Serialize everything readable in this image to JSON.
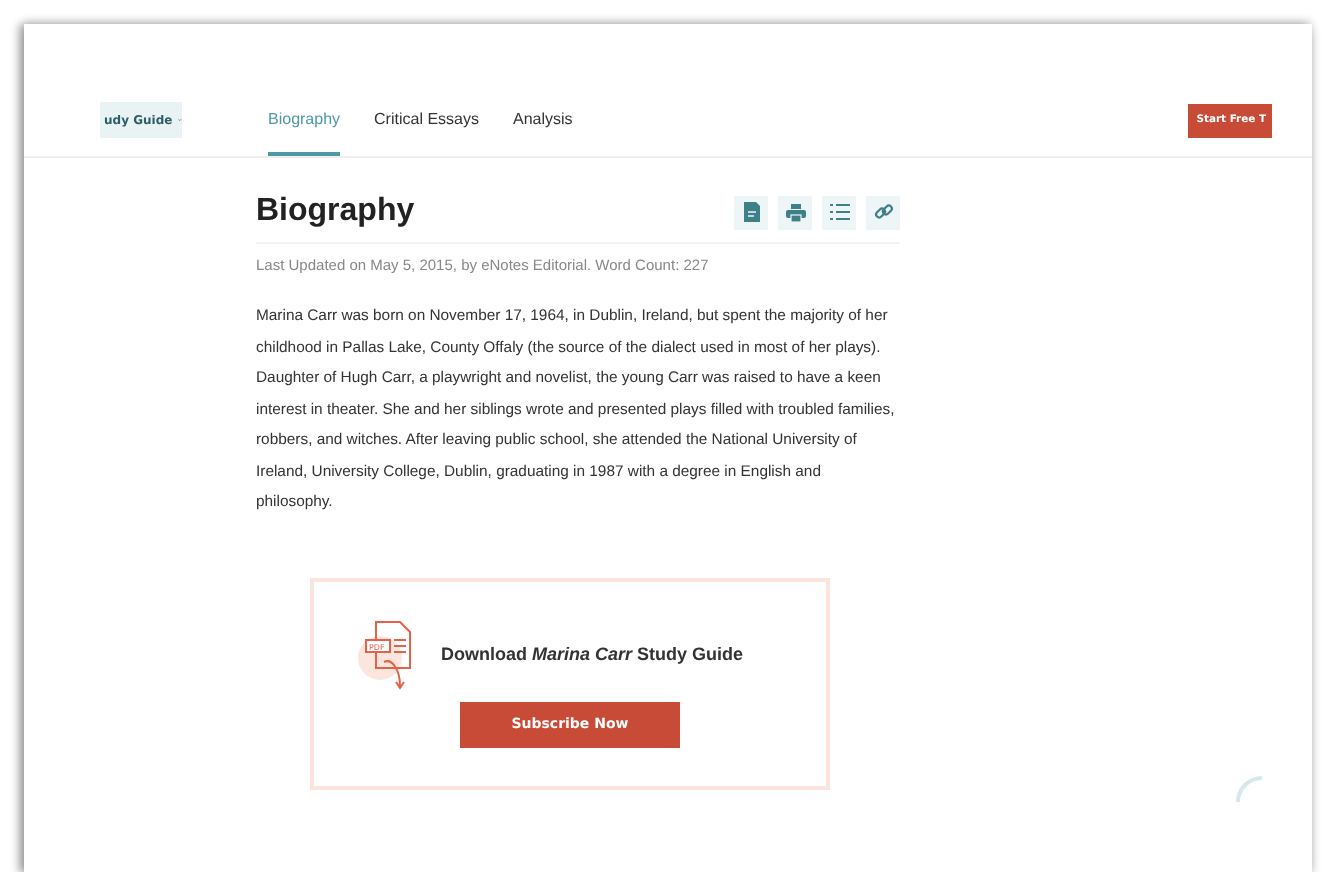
{
  "study_guide_menu": {
    "label": "udy Guide"
  },
  "tabs": [
    {
      "label": "Biography",
      "selected": true
    },
    {
      "label": "Critical Essays",
      "selected": false
    },
    {
      "label": "Analysis",
      "selected": false
    }
  ],
  "cta_button": {
    "label": "Start Free T"
  },
  "article": {
    "title": "Biography",
    "meta": "Last Updated on May 5, 2015, by eNotes Editorial. Word Count: 227",
    "body": "Marina Carr was born on November 17, 1964, in Dublin, Ireland, but spent the majority of her childhood in Pallas Lake, County Offaly (the source of the dialect used in most of her plays). Daughter of Hugh Carr, a playwright and novelist, the young Carr was raised to have a keen interest in theater. She and her siblings wrote and presented plays filled with troubled families, robbers, and witches. After leaving public school, she attended the National University of Ireland, University College, Dublin, graduating in 1987 with a degree in English and philosophy."
  },
  "promo": {
    "heading": "Download *Marina Carr* Study Guide",
    "icon_label": "PDF",
    "button": "Subscribe Now"
  }
}
